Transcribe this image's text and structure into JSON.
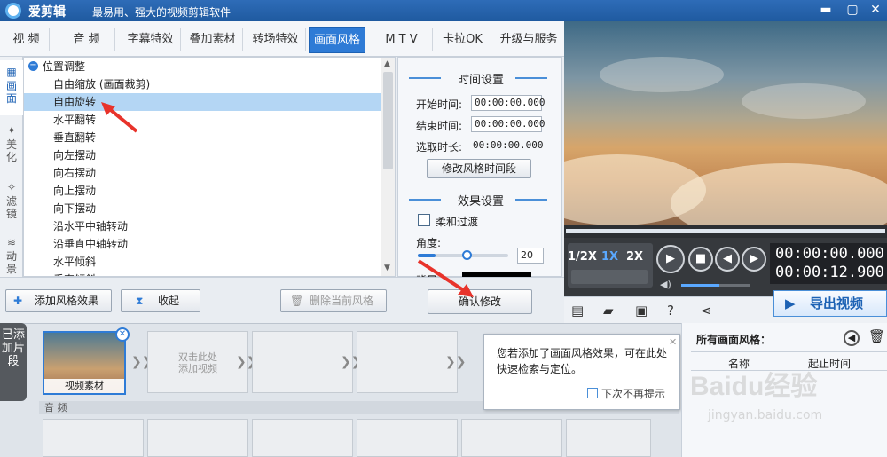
{
  "titlebar": {
    "app_name": "爱剪辑",
    "slogan": "最易用、强大的视频剪辑软件",
    "minimize": "▬",
    "maximize": "▢",
    "close": "✕"
  },
  "tabs": [
    {
      "label": "视 频"
    },
    {
      "label": "音 频"
    },
    {
      "label": "字幕特效"
    },
    {
      "label": "叠加素材"
    },
    {
      "label": "转场特效"
    },
    {
      "label": "画面风格",
      "active": true
    },
    {
      "label": "M T V"
    },
    {
      "label": "卡拉OK"
    },
    {
      "label": "升级与服务"
    }
  ],
  "vtabs": [
    {
      "label": "画面"
    },
    {
      "label": "美化"
    },
    {
      "label": "滤镜"
    },
    {
      "label": "动景"
    }
  ],
  "tree": {
    "group": "位置调整",
    "items": [
      "自由缩放 (画面裁剪)",
      "自由旋转",
      "水平翻转",
      "垂直翻转",
      "向左摆动",
      "向右摆动",
      "向上摆动",
      "向下摆动",
      "沿水平中轴转动",
      "沿垂直中轴转动",
      "水平倾斜",
      "垂直倾斜"
    ],
    "selected_index": 1
  },
  "time_settings": {
    "title": "时间设置",
    "start_label": "开始时间:",
    "start_value": "00:00:00.000",
    "end_label": "结束时间:",
    "end_value": "00:00:00.000",
    "duration_label": "选取时长:",
    "duration_value": "00:00:00.000",
    "modify_button": "修改风格时间段"
  },
  "effect_settings": {
    "title": "效果设置",
    "soft_transition": "柔和过渡",
    "angle_label": "角度:",
    "angle_value": "20",
    "angle_fraction": 0.2,
    "bg_label": "背景"
  },
  "bottom_buttons": {
    "add": "添加风格效果",
    "collapse": "收起",
    "delete": "删除当前风格",
    "confirm": "确认修改"
  },
  "player": {
    "speeds": [
      "1/2X",
      "1X",
      "2X"
    ],
    "time_current": "00:00:00.000",
    "time_total": "00:00:12.900",
    "volume_fraction": 0.55
  },
  "export": "导出视频",
  "timeline": {
    "side_label": "已添加片段",
    "clip_label": "视频素材",
    "placeholder": "双击此处\n添加视频",
    "audio_label": "音 频"
  },
  "tip": {
    "text": "您若添加了画面风格效果，可在此处快速检索与定位。",
    "checkbox": "下次不再提示"
  },
  "right_panel": {
    "title": "所有画面风格：",
    "col_name": "名称",
    "col_time": "起止时间"
  },
  "watermark": {
    "logo": "Baidu经验",
    "url": "jingyan.baidu.com"
  }
}
